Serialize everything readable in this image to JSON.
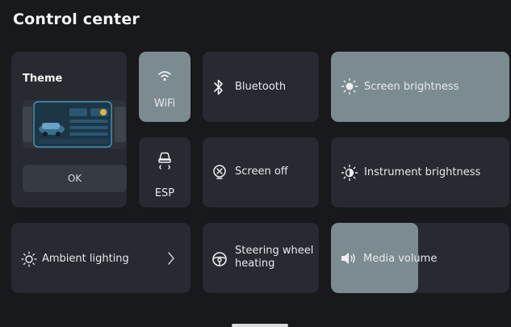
{
  "header": {
    "title": "Control center"
  },
  "theme": {
    "title": "Theme",
    "ok_label": "OK"
  },
  "tiles": {
    "wifi": {
      "label": "WiFi",
      "icon": "wifi-icon",
      "active": true
    },
    "esp": {
      "label": "ESP",
      "icon": "esp-car-icon",
      "active": false
    },
    "bluetooth": {
      "label": "Bluetooth",
      "icon": "bluetooth-icon",
      "active": false
    },
    "screen_off": {
      "label": "Screen off",
      "icon": "screen-off-icon",
      "active": false
    },
    "screen_brightness": {
      "label": "Screen brightness",
      "icon": "brightness-icon",
      "active": true
    },
    "instrument_brightness": {
      "label": "Instrument brightness",
      "icon": "half-brightness-icon",
      "active": false
    },
    "ambient_lighting": {
      "label": "Ambient lighting",
      "icon": "sun-outline-icon"
    },
    "steering_heating": {
      "label_line1": "Steering wheel",
      "label_line2": "heating",
      "icon": "steering-wheel-icon"
    },
    "media_volume": {
      "label": "Media volume",
      "icon": "speaker-icon",
      "level_percent": 49
    }
  },
  "colors": {
    "background": "#17191d",
    "tile": "#272a30",
    "active": "#7c8b8f"
  }
}
